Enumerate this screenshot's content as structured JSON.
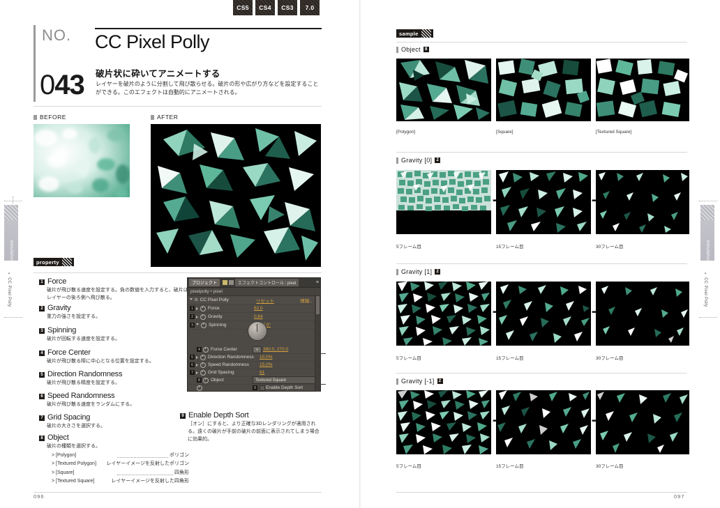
{
  "versions": [
    "CS5",
    "CS4",
    "CS3",
    "7.0"
  ],
  "left_page": {
    "no_label": "NO.",
    "number_prefix": "0",
    "number_rest": "43",
    "effect_title": "CC Pixel Polly",
    "jp_subtitle": "破片状に砕いてアニメートする",
    "jp_description": "レイヤーを破片のように分割して飛び散らせる。破片の形や広がり方などを設定することができる。このエフェクトは自動的にアニメートされる。",
    "before_label": "BEFORE",
    "after_label": "AFTER",
    "property_band": "property",
    "page_number": "096",
    "side_tab": "simulation",
    "side_sub": "CC Pixel Polly",
    "properties": [
      {
        "num": "1",
        "name": "Force",
        "desc": "破片が飛び散る速度を設定する。負の数値を入力すると、破片はレイヤーの後ろ側へ飛び散る。"
      },
      {
        "num": "2",
        "name": "Gravity",
        "desc": "重力の強さを設定する。"
      },
      {
        "num": "3",
        "name": "Spinning",
        "desc": "破片が回転する速度を設定する。"
      },
      {
        "num": "4",
        "name": "Force Center",
        "desc": "破片が飛び散る際に中心となる位置を設定する。"
      },
      {
        "num": "5",
        "name": "Direction Randomness",
        "desc": "破片が飛び散る精度を設定する。"
      },
      {
        "num": "6",
        "name": "Speed Randomness",
        "desc": "破片が飛び散る速度をランダムにする。"
      },
      {
        "num": "7",
        "name": "Grid Spacing",
        "desc": "破片の大きさを選択する。"
      },
      {
        "num": "8",
        "name": "Object",
        "desc": "破片の種類を選択する。",
        "options": [
          {
            "key": "> [Polygon]",
            "value": "ポリゴン"
          },
          {
            "key": "> [Textured Polygon]",
            "value": "レイヤーイメージを反射したポリゴン"
          },
          {
            "key": "> [Square]",
            "value": "四角形"
          },
          {
            "key": "> [Textured Square]",
            "value": "レイヤーイメージを反射した四角形"
          }
        ]
      }
    ],
    "depth_sort": {
      "num": "9",
      "name": "Enable Depth Sort",
      "desc": "［オン］にすると、より正確な3Dレンダリングが適用される。遠くの破片が手前の破片の前面に表示されてしまう場合に効果的。"
    }
  },
  "ae_panel": {
    "tabs": [
      "プロジェクト",
      "エフェクトコントロール : pixel"
    ],
    "comp_path": "pixelpolly • pixel",
    "effect_name": "CC Pixel Polly",
    "reset_label": "リセット",
    "about_label": "情報..",
    "rows": [
      {
        "num": "1",
        "name": "Force",
        "value": "82.0"
      },
      {
        "num": "2",
        "name": "Gravity",
        "value": "0.64"
      },
      {
        "num": "3",
        "name": "Spinning",
        "value": "1x +0.0°"
      },
      {
        "num": "4",
        "name": "Force Center",
        "value": "360.0, 270.0"
      },
      {
        "num": "5",
        "name": "Direction Randomness",
        "value": "10.0%"
      },
      {
        "num": "6",
        "name": "Speed Randomness",
        "value": "15.0%"
      },
      {
        "num": "7",
        "name": "Grid Spacing",
        "value": "61"
      }
    ],
    "object_row": {
      "num": "8",
      "name": "Object",
      "value": "Textured Square"
    },
    "depth_row": {
      "num": "9",
      "label": "Enable Depth Sort"
    }
  },
  "right_page": {
    "sample_band": "sample",
    "page_number": "097",
    "side_tab": "simulation",
    "side_sub": "CC Pixel Polly",
    "sections": [
      {
        "title": "Object",
        "num": "8",
        "captions": [
          "[Polygon]",
          "[Square]",
          "[Textured Square]"
        ],
        "arrows": false
      },
      {
        "title": "Gravity  [0]",
        "num": "2",
        "captions": [
          "5フレーム目",
          "15フレーム目",
          "30フレーム目"
        ],
        "arrows": true
      },
      {
        "title": "Gravity  [1]",
        "num": "2",
        "captions": [
          "5フレーム目",
          "15フレーム目",
          "30フレーム目"
        ],
        "arrows": true
      },
      {
        "title": "Gravity  [-1]",
        "num": "2",
        "captions": [
          "5フレーム目",
          "15フレーム目",
          "30フレーム目"
        ],
        "arrows": true
      }
    ]
  },
  "colors": {
    "accent_green": "#5fb79a",
    "panel_bg": "#4d4a46",
    "panel_value": "#d8a33c",
    "dark": "#1f1b18"
  }
}
